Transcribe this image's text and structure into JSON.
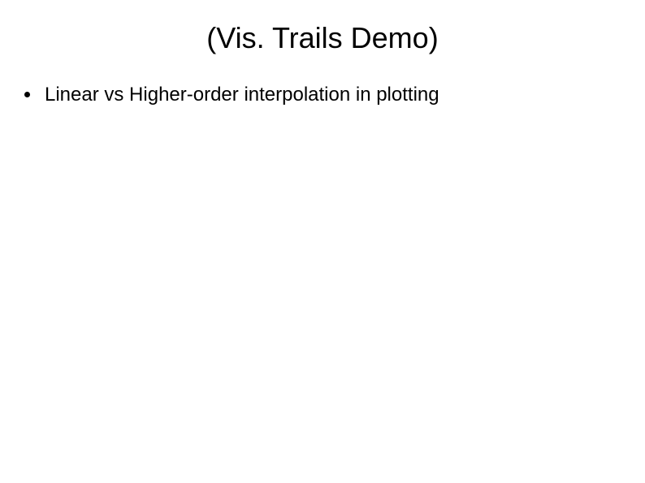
{
  "slide": {
    "title": "(Vis. Trails Demo)",
    "bullets": [
      {
        "text": "Linear vs Higher-order interpolation in plotting"
      }
    ]
  }
}
